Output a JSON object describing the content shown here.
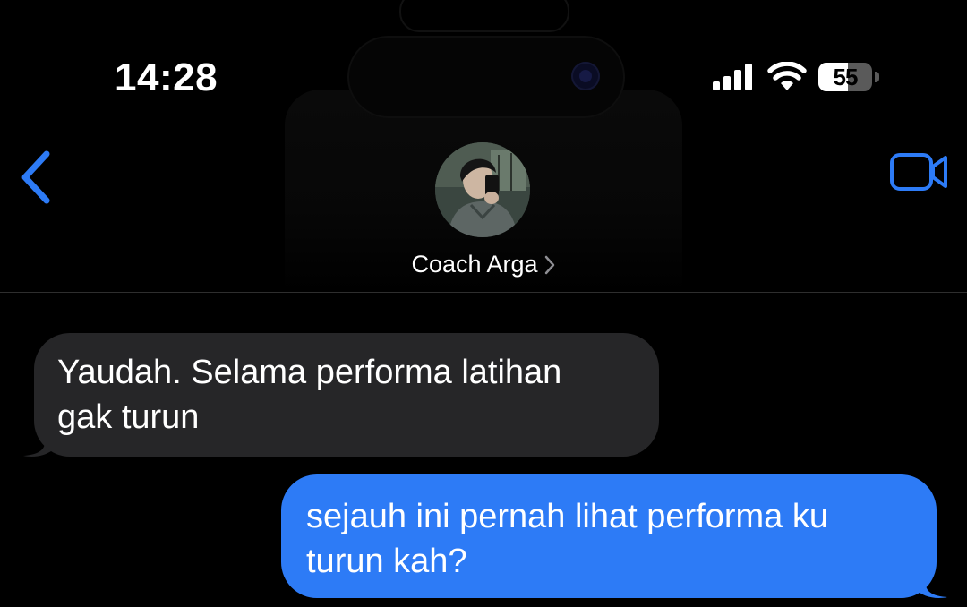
{
  "status_bar": {
    "time": "14:28",
    "battery_level": "55",
    "battery_fraction": 0.55,
    "icons": [
      "signal-icon",
      "wifi-icon",
      "battery-icon"
    ]
  },
  "header": {
    "contact_name": "Coach Arga",
    "back_icon": "chevron-left-icon",
    "video_icon": "video-call-icon",
    "accent_color": "#2d7bf6"
  },
  "messages": [
    {
      "direction": "incoming",
      "text_lines": [
        "Yaudah. Selama performa latihan",
        "gak turun"
      ],
      "bubble_color": "#262628"
    },
    {
      "direction": "outgoing",
      "text_lines": [
        "sejauh ini pernah lihat performa ku",
        "turun kah?"
      ],
      "bubble_color": "#2d7bf6"
    }
  ]
}
